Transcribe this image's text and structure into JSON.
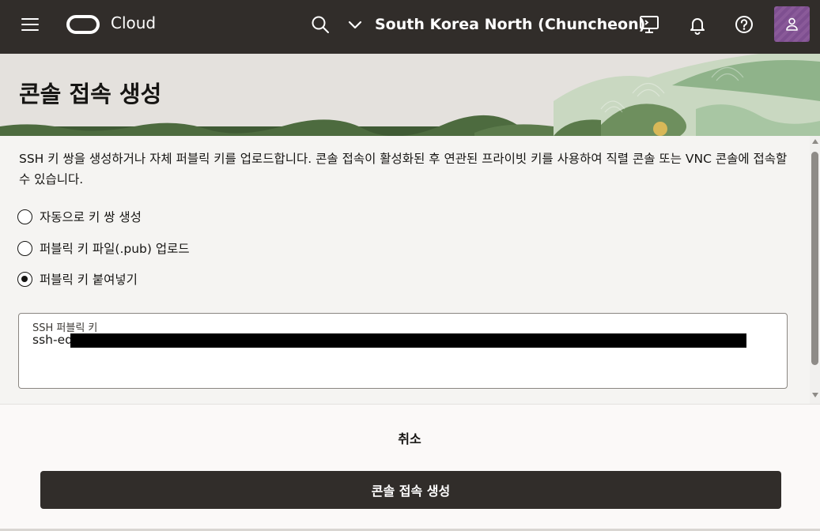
{
  "topbar": {
    "brand": "Cloud",
    "region": "South Korea North (Chuncheon)",
    "icons": [
      "menu-icon",
      "oracle-logo-icon",
      "search-icon",
      "chevron-down-icon",
      "cloud-shell-icon",
      "bell-icon",
      "help-icon",
      "user-icon"
    ]
  },
  "page": {
    "title": "콘솔 접속 생성"
  },
  "form": {
    "description": "SSH 키 쌍을 생성하거나 자체 퍼블릭 키를 업로드합니다. 콘솔 접속이 활성화된 후 연관된 프라이빗 키를 사용하여 직렬 콘솔 또는 VNC 콘솔에 접속할 수 있습니다.",
    "options": [
      {
        "label": "자동으로 키 쌍 생성",
        "checked": false
      },
      {
        "label": "퍼블릭 키 파일(.pub) 업로드",
        "checked": false
      },
      {
        "label": "퍼블릭 키 붙여넣기",
        "checked": true
      }
    ],
    "ssh_key_label": "SSH 퍼블릭 키",
    "ssh_key_value": "ssh-ed"
  },
  "footer": {
    "cancel_label": "취소",
    "create_label": "콘솔 접속 생성"
  }
}
